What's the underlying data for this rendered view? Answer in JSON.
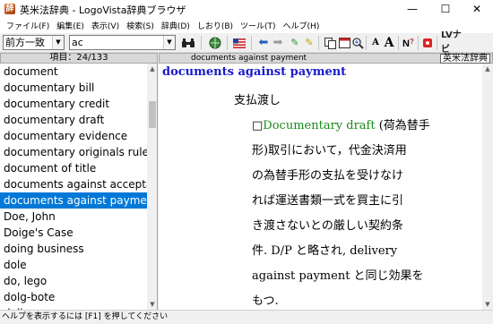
{
  "window": {
    "title": "英米法辞典 - LogoVista辞典ブラウザ",
    "minimize": "—",
    "maximize": "☐",
    "close": "✕"
  },
  "menu": [
    "ファイル(F)",
    "編集(E)",
    "表示(V)",
    "検索(S)",
    "辞典(D)",
    "しおり(B)",
    "ツール(T)",
    "ヘルプ(H)"
  ],
  "toolbar": {
    "search_mode": "前方一致",
    "search_value": "ac",
    "icons": [
      "binoculars-icon",
      "globe-icon",
      "flag-icon",
      "back-arrow-icon",
      "forward-arrow-icon",
      "marker-green-icon",
      "marker-yellow-icon",
      "copy-icon",
      "window-icon",
      "zoom-icon",
      "font-smaller-icon",
      "font-larger-icon",
      "help-icon",
      "stop-icon",
      "lv-navi-icon"
    ],
    "font_smaller": "A",
    "font_larger": "A",
    "lv_navi": "LVナビ"
  },
  "list": {
    "header": "項目：24/133",
    "items": [
      "document",
      "documentary bill",
      "documentary credit",
      "documentary draft",
      "documentary evidence",
      "documentary originals rule",
      "document of title",
      "documents against acceptance",
      "documents against payment",
      "Doe, John",
      "Doige's Case",
      "doing business",
      "dole",
      "do, lego",
      "dolg-bote",
      "doli capax"
    ],
    "selected_index": 8
  },
  "entry": {
    "header_word": "documents against payment",
    "dictionary": "英米法辞典",
    "headword": "documents against payment",
    "pos": "支払渡し",
    "body": [
      {
        "prefix": "□",
        "green": "Documentary draft",
        "text": " (荷為替手"
      },
      {
        "text": "形)取引において，代金決済用"
      },
      {
        "text": "の為替手形の支払を受けなけ"
      },
      {
        "text": "れば運送書類一式を買主に引"
      },
      {
        "text": "き渡さないとの厳しい契約条"
      },
      {
        "text": "件. D/P と略され, delivery"
      },
      {
        "text": "against payment と同じ効果を"
      },
      {
        "text": "もつ."
      }
    ]
  },
  "status": {
    "text": "ヘルプを表示するには [F1] を押してください"
  },
  "colors": {
    "selection": "#0078d7",
    "headword": "#1a1acc",
    "cross_ref": "#1a8a1a"
  }
}
